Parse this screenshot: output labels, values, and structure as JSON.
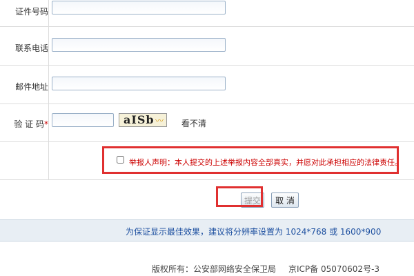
{
  "form": {
    "id_number": {
      "label": "证件号码",
      "value": ""
    },
    "phone": {
      "label": "联系电话",
      "value": ""
    },
    "email": {
      "label": "邮件地址",
      "value": ""
    },
    "captcha": {
      "label": "验 证 码",
      "required_mark": "*",
      "value": "",
      "image_text": "aISb",
      "refresh_text": "看不清"
    }
  },
  "declaration": {
    "checked": false,
    "text": "举报人声明：本人提交的上述举报内容全部真实，并愿对此承担相应的法律责任。"
  },
  "buttons": {
    "submit_label": "提交",
    "cancel_label": "取 消"
  },
  "notice": {
    "text": "为保证显示最佳效果，建议将分辨率设置为 1024*768 或 1600*900"
  },
  "footer": {
    "copyright": "版权所有：公安部网络安全保卫局",
    "icp": "京ICP备 05070602号-3"
  },
  "colors": {
    "highlight_red": "#e03030",
    "notice_blue": "#1e50a0",
    "required_red": "#cc0000"
  }
}
